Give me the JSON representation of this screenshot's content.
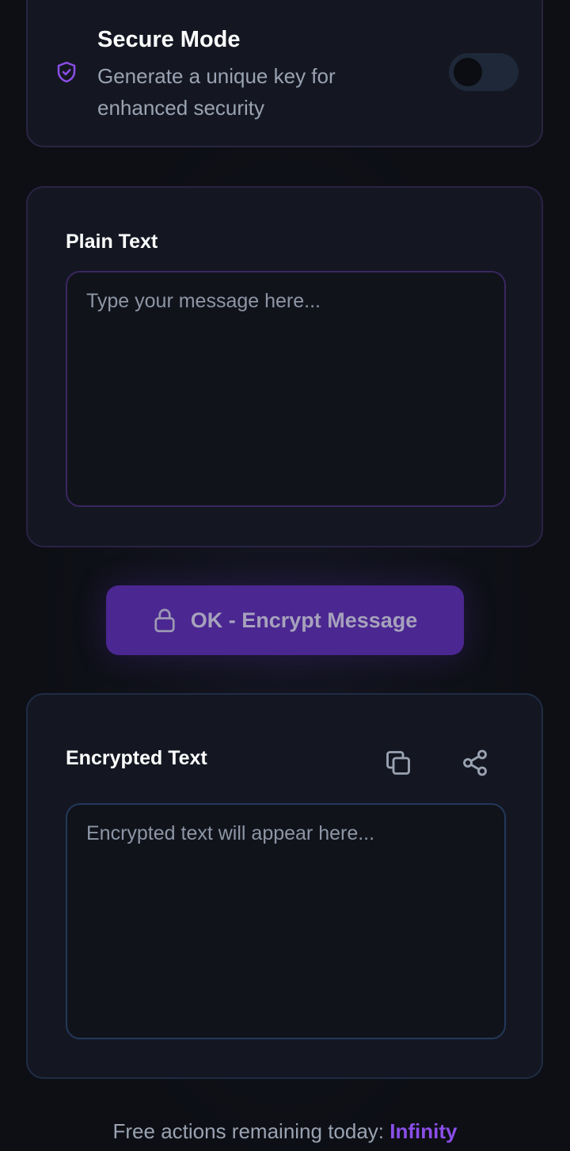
{
  "secure_mode": {
    "title": "Secure Mode",
    "description": "Generate a unique key for enhanced security",
    "toggle_state": "off"
  },
  "plain": {
    "label": "Plain Text",
    "placeholder": "Type your message here..."
  },
  "encrypt_button": {
    "label": "OK - Encrypt Message",
    "icon": "lock-icon"
  },
  "encrypted": {
    "label": "Encrypted Text",
    "placeholder": "Encrypted text will appear here...",
    "icons": [
      "copy-icon",
      "share-icon"
    ]
  },
  "footer": {
    "text": "Free actions remaining today:",
    "value": "Infinity"
  },
  "colors": {
    "accent": "#8b4ee8",
    "button": "#4b2791",
    "background": "#0d0f15"
  }
}
